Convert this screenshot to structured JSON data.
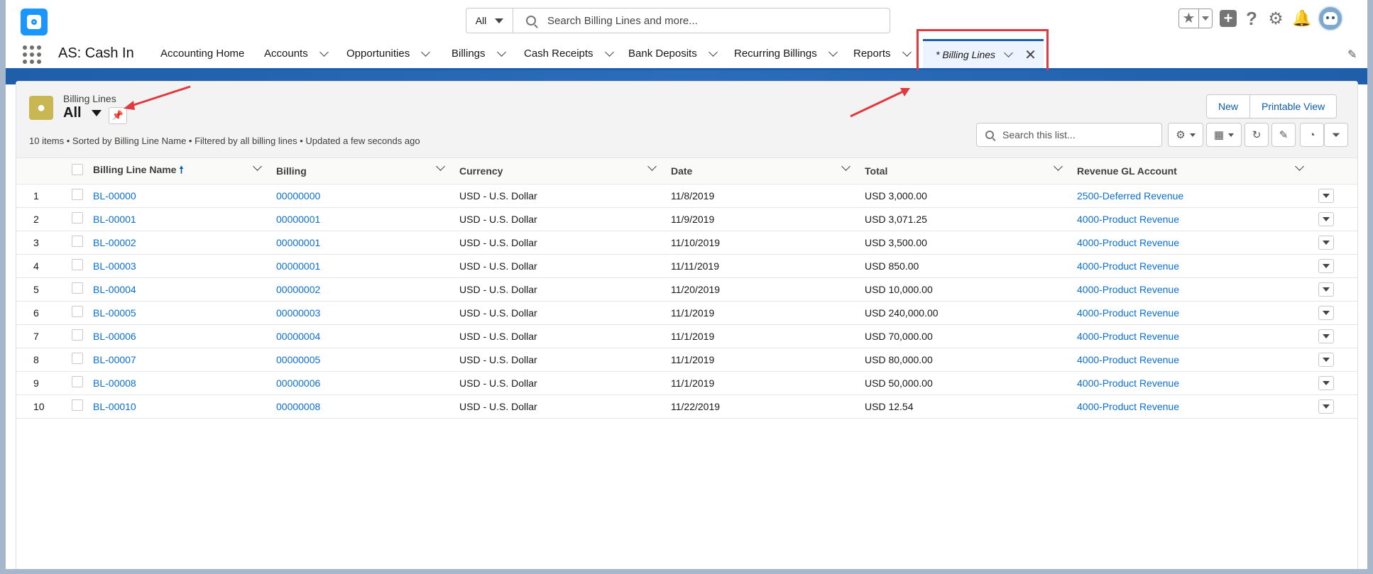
{
  "header": {
    "search_scope": "All",
    "search_placeholder": "Search Billing Lines and more..."
  },
  "navbar": {
    "app_name": "AS: Cash In",
    "items": [
      {
        "label": "Accounting Home"
      },
      {
        "label": "Accounts"
      },
      {
        "label": "Opportunities"
      },
      {
        "label": "Billings"
      },
      {
        "label": "Cash Receipts"
      },
      {
        "label": "Bank Deposits"
      },
      {
        "label": "Recurring Billings"
      },
      {
        "label": "Reports"
      }
    ],
    "active_tab": "* Billing Lines"
  },
  "list": {
    "object_label": "Billing Lines",
    "view_name": "All",
    "meta": "10 items • Sorted by Billing Line Name • Filtered by all billing lines • Updated a few seconds ago",
    "new_label": "New",
    "printable_label": "Printable View",
    "search_placeholder": "Search this list...",
    "columns": [
      "Billing Line Name",
      "Billing",
      "Currency",
      "Date",
      "Total",
      "Revenue GL Account"
    ],
    "rows": [
      {
        "num": "1",
        "name": "BL-00000",
        "billing": "00000000",
        "currency": "USD - U.S. Dollar",
        "date": "11/8/2019",
        "total": "USD 3,000.00",
        "gl": "2500-Deferred Revenue"
      },
      {
        "num": "2",
        "name": "BL-00001",
        "billing": "00000001",
        "currency": "USD - U.S. Dollar",
        "date": "11/9/2019",
        "total": "USD 3,071.25",
        "gl": "4000-Product Revenue"
      },
      {
        "num": "3",
        "name": "BL-00002",
        "billing": "00000001",
        "currency": "USD - U.S. Dollar",
        "date": "11/10/2019",
        "total": "USD 3,500.00",
        "gl": "4000-Product Revenue"
      },
      {
        "num": "4",
        "name": "BL-00003",
        "billing": "00000001",
        "currency": "USD - U.S. Dollar",
        "date": "11/11/2019",
        "total": "USD 850.00",
        "gl": "4000-Product Revenue"
      },
      {
        "num": "5",
        "name": "BL-00004",
        "billing": "00000002",
        "currency": "USD - U.S. Dollar",
        "date": "11/20/2019",
        "total": "USD 10,000.00",
        "gl": "4000-Product Revenue"
      },
      {
        "num": "6",
        "name": "BL-00005",
        "billing": "00000003",
        "currency": "USD - U.S. Dollar",
        "date": "11/1/2019",
        "total": "USD 240,000.00",
        "gl": "4000-Product Revenue"
      },
      {
        "num": "7",
        "name": "BL-00006",
        "billing": "00000004",
        "currency": "USD - U.S. Dollar",
        "date": "11/1/2019",
        "total": "USD 70,000.00",
        "gl": "4000-Product Revenue"
      },
      {
        "num": "8",
        "name": "BL-00007",
        "billing": "00000005",
        "currency": "USD - U.S. Dollar",
        "date": "11/1/2019",
        "total": "USD 80,000.00",
        "gl": "4000-Product Revenue"
      },
      {
        "num": "9",
        "name": "BL-00008",
        "billing": "00000006",
        "currency": "USD - U.S. Dollar",
        "date": "11/1/2019",
        "total": "USD 50,000.00",
        "gl": "4000-Product Revenue"
      },
      {
        "num": "10",
        "name": "BL-00010",
        "billing": "00000008",
        "currency": "USD - U.S. Dollar",
        "date": "11/22/2019",
        "total": "USD 12.54",
        "gl": "4000-Product Revenue"
      }
    ]
  },
  "colors": {
    "brand_blue": "#1b5fad",
    "link": "#0b6fd3",
    "annotation_red": "#e0393e",
    "object_icon": "#c8b752"
  }
}
